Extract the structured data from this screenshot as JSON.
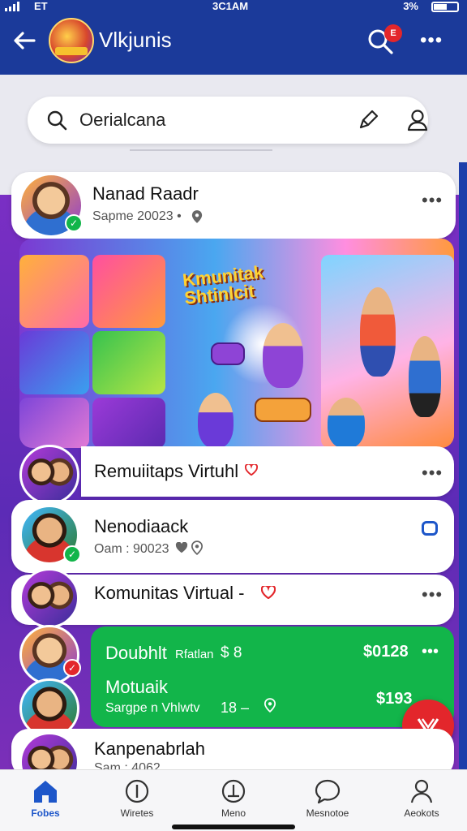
{
  "status_bar": {
    "carrier": "ET",
    "time": "3C1AM",
    "battery": "3%"
  },
  "header": {
    "title": "Vlkjunis",
    "notification_count": "E"
  },
  "search": {
    "value": "Oerialcana"
  },
  "post": {
    "author": "Nanad Raadr",
    "meta": "Sapme 20023 •",
    "banner_title": "Kmunitak Shtinlcit"
  },
  "rows": [
    {
      "title": "Remuiitaps Virtuhl"
    },
    {
      "title": "Nenodiaack",
      "meta": "Oam : 90023"
    },
    {
      "title": "Komunitas Virtual -"
    }
  ],
  "green_card": {
    "line1_left": "Doubhlt",
    "line1_mid": "Rfatlan",
    "line1_val": "$ 8",
    "line1_right": "$0128",
    "line2_title": "Motuaik",
    "line2_sub": "Sargpe n Vhlwtv",
    "line2_num": "18 –",
    "line2_right": "$193"
  },
  "last_row": {
    "title": "Kanpenabrlah",
    "meta": "Sam : 4062"
  },
  "bottom_nav": [
    {
      "label": "Fobes"
    },
    {
      "label": "Wiretes"
    },
    {
      "label": "Meno"
    },
    {
      "label": "Mesnotoe"
    },
    {
      "label": "Aeokots"
    }
  ],
  "colors": {
    "app_bar": "#1b3a9a",
    "accent_green": "#12b54a",
    "accent_red": "#e3262b",
    "feed_purple": "#6a2cbe"
  }
}
